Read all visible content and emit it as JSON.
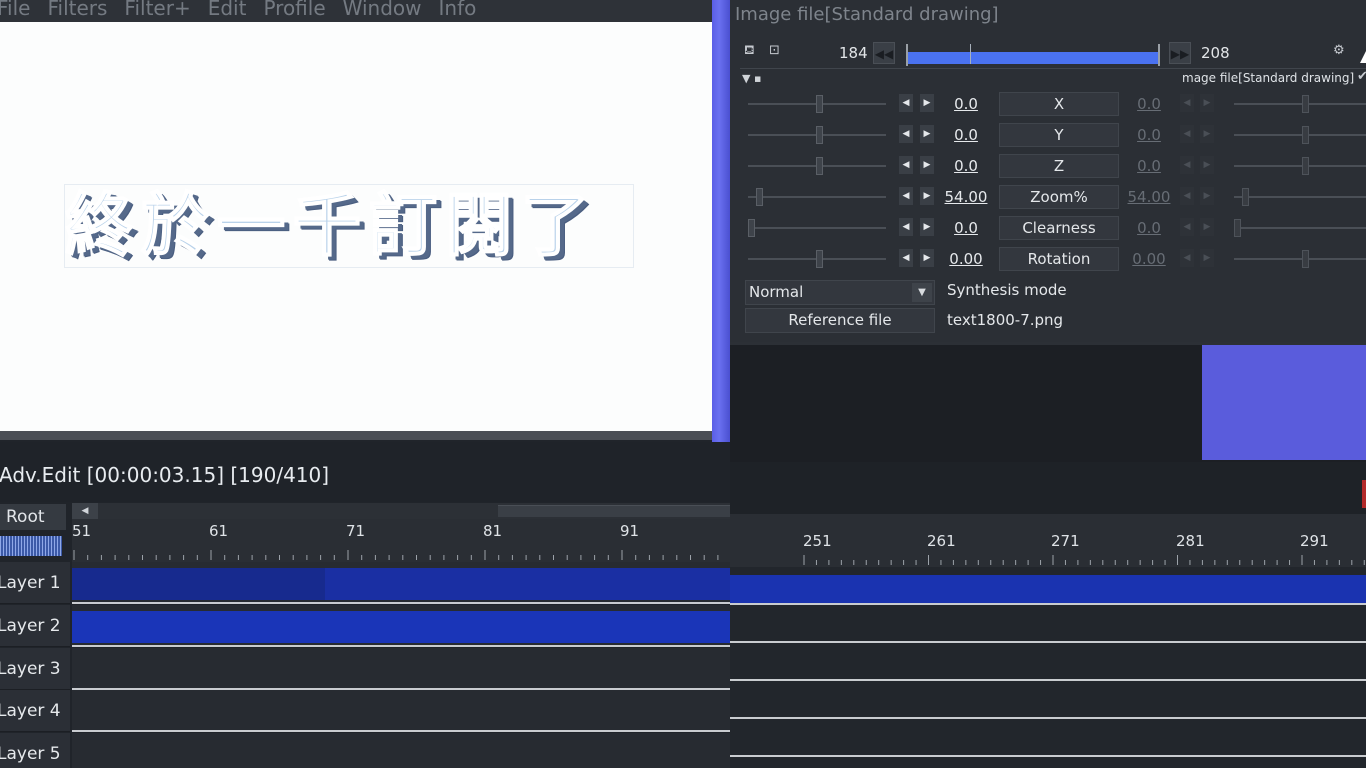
{
  "menu": [
    "File",
    "Filters",
    "Filter+",
    "Edit",
    "Profile",
    "Window",
    "Info"
  ],
  "preview": {
    "text": "終於一千訂閱了"
  },
  "timeline": {
    "title": "Adv.Edit [00:00:03.15] [190/410]",
    "root_label": "Root",
    "ruler_left": [
      "51",
      "61",
      "71",
      "81",
      "91"
    ],
    "ruler_right": [
      "251",
      "261",
      "271",
      "281",
      "291"
    ],
    "layers": [
      "Layer 1",
      "Layer 2",
      "Layer 3",
      "Layer 4",
      "Layer 5"
    ]
  },
  "settings": {
    "title": "Image file[Standard drawing]",
    "frame_start": "184",
    "frame_end": "208",
    "object_name": "mage file[Standard drawing]",
    "params": [
      {
        "name": "X",
        "left": "0.0",
        "right": "0.0"
      },
      {
        "name": "Y",
        "left": "0.0",
        "right": "0.0"
      },
      {
        "name": "Z",
        "left": "0.0",
        "right": "0.0"
      },
      {
        "name": "Zoom%",
        "left": "54.00",
        "right": "54.00"
      },
      {
        "name": "Clearness",
        "left": "0.0",
        "right": "0.0"
      },
      {
        "name": "Rotation",
        "left": "0.00",
        "right": "0.00"
      }
    ],
    "blend_mode": "Normal",
    "synthesis_label": "Synthesis mode",
    "reference_button": "Reference file",
    "reference_file": "text1800-7.png"
  },
  "colors": {
    "accent": "#4a72f0",
    "clip": "#1a2fa0",
    "background": "#20242a"
  }
}
